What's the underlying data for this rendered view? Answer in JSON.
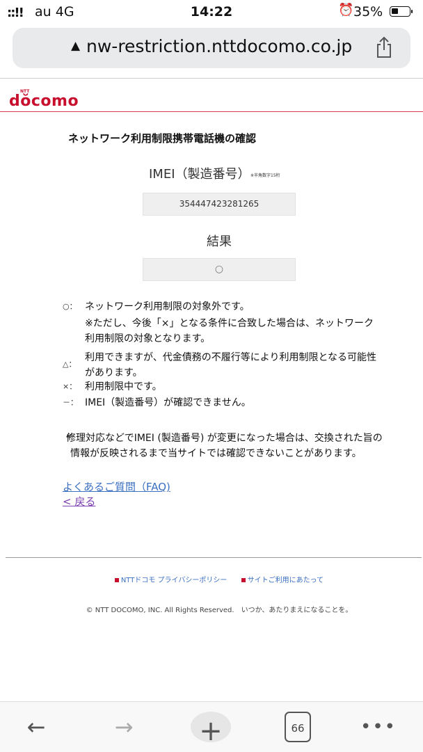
{
  "status_bar": {
    "signal": "::!!",
    "carrier": "au  4G",
    "time": "14:22",
    "alarm_icon": "alarm-clock-icon",
    "battery": "35%"
  },
  "url_bar": {
    "url": "nw-restriction.nttdocomo.co.jp",
    "lock_icon": "▲"
  },
  "header": {
    "logo_text": "dŏcomo",
    "logo_small": "NTT"
  },
  "page": {
    "title": "ネットワーク利用制限携帯電話機の確認",
    "imei_label": "IMEI（製造番号）",
    "imei_note": "※半角数字15桁",
    "imei_value": "354447423281265",
    "result_label": "結果",
    "result_value": "○"
  },
  "legend": [
    {
      "symbol": "○：",
      "text": "ネットワーク利用制限の対象外です。"
    },
    {
      "symbol": "",
      "text": "※ただし、今後「×」となる条件に合致した場合は、ネットワーク利用制限の対象となります。"
    },
    {
      "symbol": "△：",
      "text": "利用できますが、代金債務の不履行等により利用制限となる可能性があります。"
    },
    {
      "symbol": "×：",
      "text": "利用制限中です。"
    },
    {
      "symbol": "－：",
      "text": "IMEI（製造番号）が確認できません。"
    }
  ],
  "note": {
    "mark": "※",
    "text": "修理対応などでIMEI (製造番号) が変更になった場合は、交換された旨の情報が反映されるまで当サイトでは確認できないことがあります。"
  },
  "links": {
    "faq": "よくあるご質問（FAQ)",
    "back": "< 戻る"
  },
  "footer": {
    "privacy": "NTTドコモ プライバシーポリシー",
    "terms": "サイトご利用にあたって",
    "copyright": "© NTT DOCOMO, INC. All Rights Reserved.　いつか、あたりまえになることを。"
  },
  "toolbar": {
    "back": "←",
    "forward": "→",
    "new_tab": "+",
    "tab_count": "66",
    "more": "•••"
  },
  "colors": {
    "brand_red": "#c8102e",
    "link_blue": "#3a6fc1",
    "visited_purple": "#7a3fb0"
  }
}
